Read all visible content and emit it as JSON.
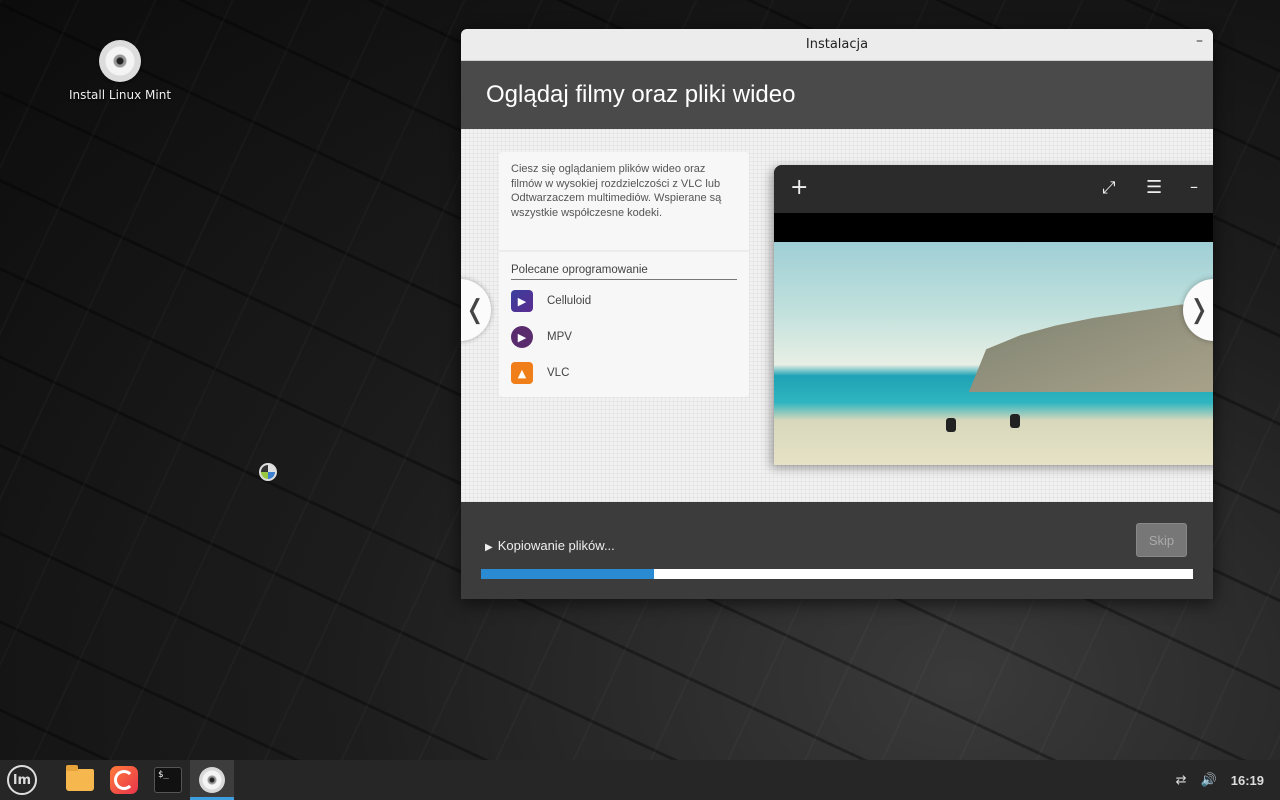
{
  "desktop": {
    "icon_label": "Install Linux Mint"
  },
  "window": {
    "title": "Instalacja",
    "minimize_glyph": "–",
    "header_title": "Oglądaj filmy oraz pliki wideo",
    "slide": {
      "description": "Ciesz się oglądaniem plików wideo oraz filmów w wysokiej rozdzielczości z VLC lub Odtwarzaczem multimediów. Wspierane są wszystkie współczesne kodeki.",
      "recommended_title": "Polecane oprogramowanie",
      "apps": [
        {
          "name": "Celluloid",
          "icon": "celluloid-icon"
        },
        {
          "name": "MPV",
          "icon": "mpv-icon"
        },
        {
          "name": "VLC",
          "icon": "vlc-icon"
        }
      ],
      "prev_glyph": "❬",
      "next_glyph": "❭"
    },
    "player": {
      "add_glyph": "+",
      "fullscreen_glyph": "⤢",
      "menu_glyph": "☰",
      "minimize_glyph": "–"
    },
    "status_text": "Kopiowanie plików...",
    "skip_label": "Skip",
    "progress_fraction": 0.243
  },
  "taskbar": {
    "menu_glyph": "lm",
    "terminal_glyph": "$_",
    "clock": "16:19",
    "network_icon": "network-icon",
    "volume_icon": "volume-icon"
  },
  "colors": {
    "progress": "#2a8ad2",
    "accent": "#3f9ede"
  }
}
